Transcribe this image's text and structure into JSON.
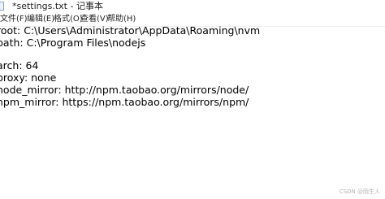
{
  "window": {
    "title": "*settings.txt - 记事本"
  },
  "menu": {
    "items": [
      "文件(F)",
      "编辑(E)",
      "格式(O)",
      "查看(V)",
      "帮助(H)"
    ]
  },
  "editor": {
    "lines": [
      "root: C:\\Users\\Administrator\\AppData\\Roaming\\nvm",
      "path: C:\\Program Files\\nodejs",
      "",
      "arch: 64",
      "proxy: none",
      "node_mirror: http://npm.taobao.org/mirrors/node/",
      "npm_mirror: https://npm.taobao.org/mirrors/npm/"
    ]
  },
  "watermark": "CSDN @陌生人"
}
